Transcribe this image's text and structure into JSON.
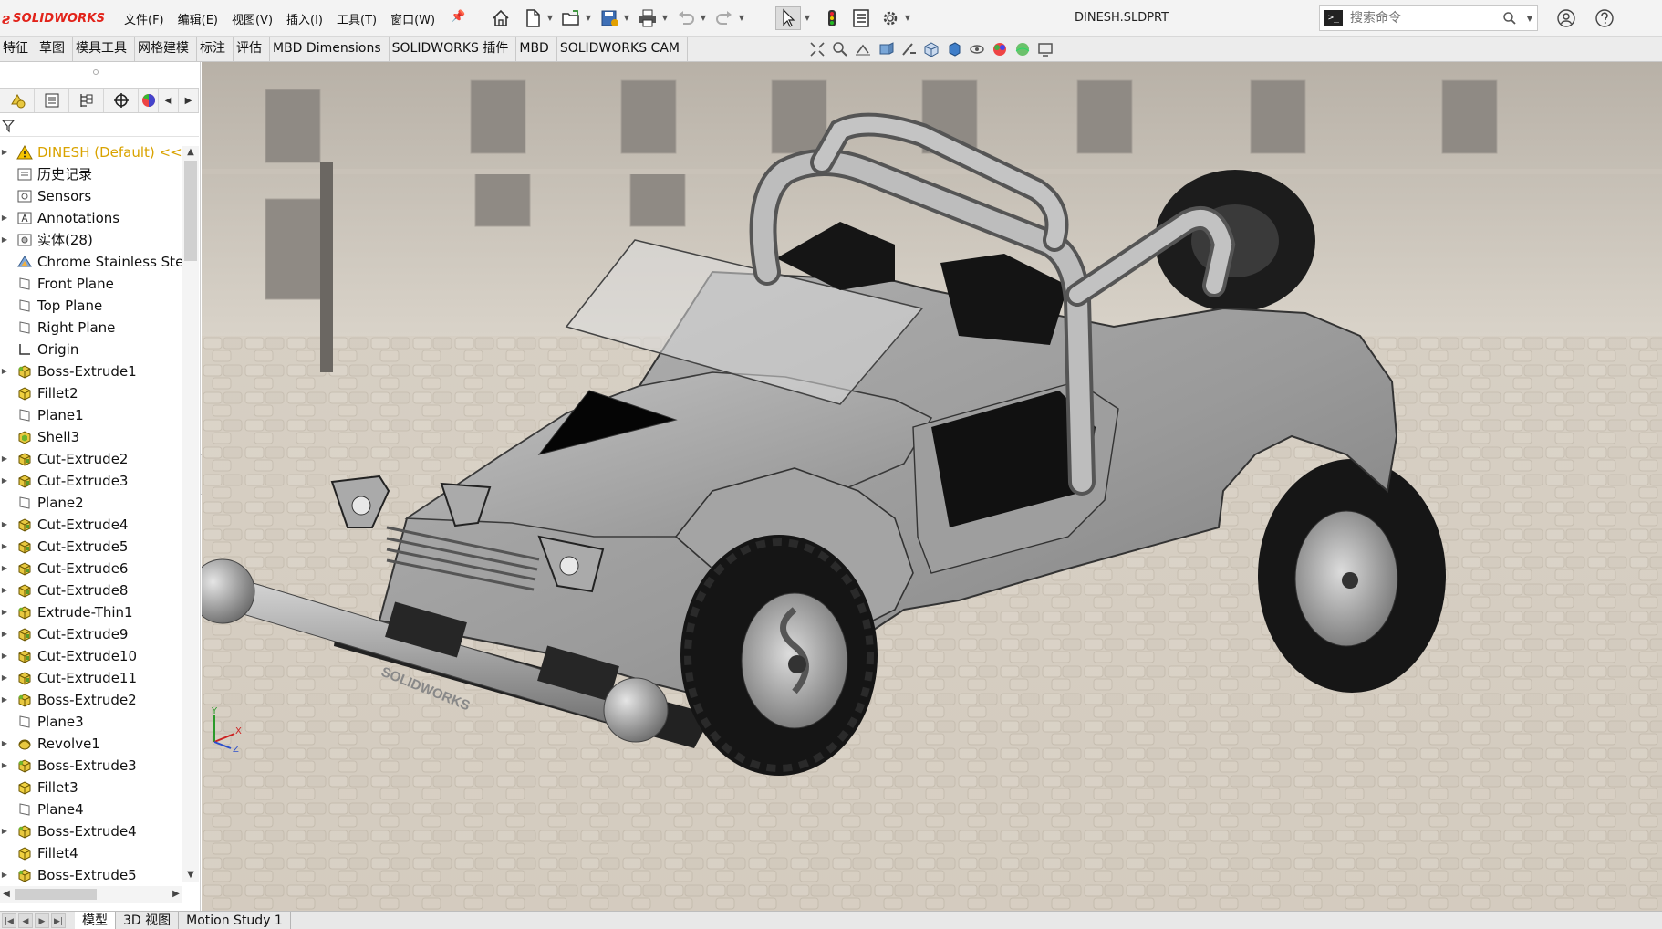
{
  "app": {
    "brand": "SOLIDWORKS",
    "document_title": "DINESH.SLDPRT"
  },
  "menus": [
    "文件(F)",
    "编辑(E)",
    "视图(V)",
    "插入(I)",
    "工具(T)",
    "窗口(W)"
  ],
  "search": {
    "placeholder": "搜索命令"
  },
  "command_tabs": [
    "特征",
    "草图",
    "模具工具",
    "网格建模",
    "标注",
    "评估",
    "MBD Dimensions",
    "SOLIDWORKS 插件",
    "MBD",
    "SOLIDWORKS CAM"
  ],
  "feature_tree": {
    "root": "DINESH  (Default) <<D",
    "items": [
      {
        "label": "历史记录",
        "icon": "history-icon",
        "expandable": false
      },
      {
        "label": "Sensors",
        "icon": "sensors-icon",
        "expandable": false
      },
      {
        "label": "Annotations",
        "icon": "annotations-icon",
        "expandable": true
      },
      {
        "label": "实体(28)",
        "icon": "solid-bodies-icon",
        "expandable": true
      },
      {
        "label": "Chrome Stainless Stee",
        "icon": "material-icon",
        "expandable": false
      },
      {
        "label": "Front Plane",
        "icon": "plane-icon",
        "expandable": false
      },
      {
        "label": "Top Plane",
        "icon": "plane-icon",
        "expandable": false
      },
      {
        "label": "Right Plane",
        "icon": "plane-icon",
        "expandable": false
      },
      {
        "label": "Origin",
        "icon": "origin-icon",
        "expandable": false
      },
      {
        "label": "Boss-Extrude1",
        "icon": "boss-extrude-icon",
        "expandable": true
      },
      {
        "label": "Fillet2",
        "icon": "fillet-icon",
        "expandable": false
      },
      {
        "label": "Plane1",
        "icon": "plane-icon",
        "expandable": false
      },
      {
        "label": "Shell3",
        "icon": "shell-icon",
        "expandable": false
      },
      {
        "label": "Cut-Extrude2",
        "icon": "cut-extrude-icon",
        "expandable": true
      },
      {
        "label": "Cut-Extrude3",
        "icon": "cut-extrude-icon",
        "expandable": true
      },
      {
        "label": "Plane2",
        "icon": "plane-icon",
        "expandable": false
      },
      {
        "label": "Cut-Extrude4",
        "icon": "cut-extrude-icon",
        "expandable": true
      },
      {
        "label": "Cut-Extrude5",
        "icon": "cut-extrude-icon",
        "expandable": true
      },
      {
        "label": "Cut-Extrude6",
        "icon": "cut-extrude-icon",
        "expandable": true
      },
      {
        "label": "Cut-Extrude8",
        "icon": "cut-extrude-icon",
        "expandable": true
      },
      {
        "label": "Extrude-Thin1",
        "icon": "boss-extrude-icon",
        "expandable": true
      },
      {
        "label": "Cut-Extrude9",
        "icon": "cut-extrude-icon",
        "expandable": true
      },
      {
        "label": "Cut-Extrude10",
        "icon": "cut-extrude-icon",
        "expandable": true
      },
      {
        "label": "Cut-Extrude11",
        "icon": "cut-extrude-icon",
        "expandable": true
      },
      {
        "label": "Boss-Extrude2",
        "icon": "boss-extrude-icon",
        "expandable": true
      },
      {
        "label": "Plane3",
        "icon": "plane-icon",
        "expandable": false
      },
      {
        "label": "Revolve1",
        "icon": "revolve-icon",
        "expandable": true
      },
      {
        "label": "Boss-Extrude3",
        "icon": "boss-extrude-icon",
        "expandable": true
      },
      {
        "label": "Fillet3",
        "icon": "fillet-icon",
        "expandable": false
      },
      {
        "label": "Plane4",
        "icon": "plane-icon",
        "expandable": false
      },
      {
        "label": "Boss-Extrude4",
        "icon": "boss-extrude-icon",
        "expandable": true
      },
      {
        "label": "Fillet4",
        "icon": "fillet-icon",
        "expandable": false
      },
      {
        "label": "Boss-Extrude5",
        "icon": "boss-extrude-icon",
        "expandable": true
      }
    ]
  },
  "viewport": {
    "model_logo_text": "SOLIDWORKS",
    "triad": {
      "x": "X",
      "y": "Y",
      "z": "Z"
    }
  },
  "bottom_tabs": [
    "模型",
    "3D 视图",
    "Motion Study 1"
  ],
  "colors": {
    "brand_red": "#e2231a",
    "root_warning_yellow": "#d9a300",
    "feature_green": "#6fb52c",
    "feature_yellow": "#e8c840"
  }
}
